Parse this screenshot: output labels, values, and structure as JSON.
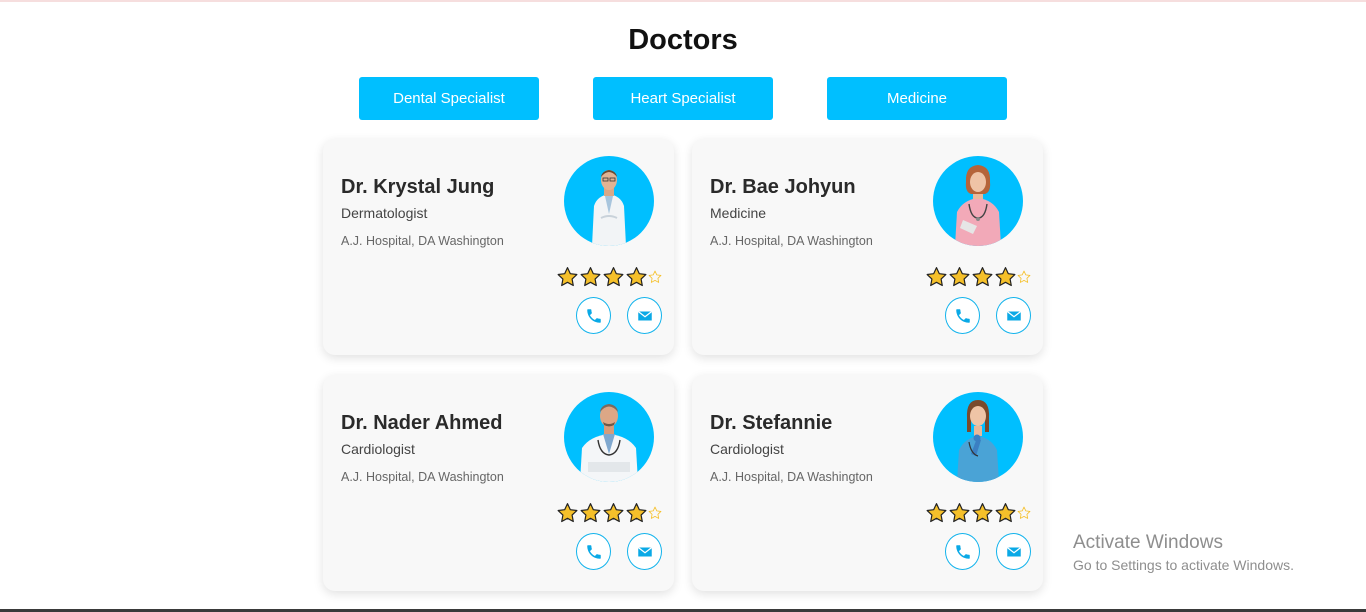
{
  "page": {
    "title": "Doctors"
  },
  "filters": [
    {
      "label": "Dental Specialist"
    },
    {
      "label": "Heart Specialist"
    },
    {
      "label": "Medicine"
    }
  ],
  "doctors": [
    {
      "name": "Dr. Krystal Jung",
      "specialty": "Dermatologist",
      "hospital": "A.J. Hospital, DA Washington",
      "rating": 4,
      "max_rating": 5,
      "photo": "doctor-male-labcoat"
    },
    {
      "name": "Dr. Bae Johyun",
      "specialty": "Medicine",
      "hospital": "A.J. Hospital, DA Washington",
      "rating": 4,
      "max_rating": 5,
      "photo": "doctor-female-pink-scrubs"
    },
    {
      "name": "Dr. Nader Ahmed",
      "specialty": "Cardiologist",
      "hospital": "A.J. Hospital, DA Washington",
      "rating": 4,
      "max_rating": 5,
      "photo": "doctor-male-arms-crossed"
    },
    {
      "name": "Dr. Stefannie",
      "specialty": "Cardiologist",
      "hospital": "A.J. Hospital, DA Washington",
      "rating": 4,
      "max_rating": 5,
      "photo": "doctor-female-blue-scrubs"
    }
  ],
  "icons": {
    "phone": "phone-icon",
    "mail": "envelope-icon",
    "star": "star-icon"
  },
  "colors": {
    "accent": "#00bfff",
    "star": "#f5c02a",
    "card_bg": "#f8f8f8"
  },
  "watermark": {
    "title": "Activate Windows",
    "subtitle": "Go to Settings to activate Windows."
  }
}
